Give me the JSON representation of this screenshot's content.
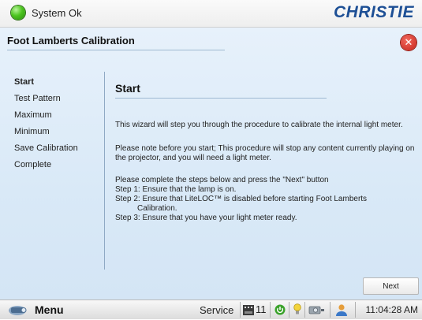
{
  "status": {
    "text": "System Ok",
    "color": "#4cc41f"
  },
  "brand": {
    "logo_text": "CHRISTIE"
  },
  "window": {
    "title": "Foot Lamberts Calibration",
    "close_icon": "close-icon"
  },
  "steps": [
    {
      "label": "Start",
      "active": true
    },
    {
      "label": "Test Pattern",
      "active": false
    },
    {
      "label": "Maximum",
      "active": false
    },
    {
      "label": "Minimum",
      "active": false
    },
    {
      "label": "Save Calibration",
      "active": false
    },
    {
      "label": "Complete",
      "active": false
    }
  ],
  "content": {
    "title": "Start",
    "intro": "This wizard will step you through the procedure to calibrate the internal light meter.",
    "note": "Please note before you start; This procedure will stop any content currently playing on the projector, and you will need a light meter.",
    "instructions": "Please complete the steps below and press the \"Next\" button",
    "step1": "Step 1: Ensure that the lamp is on.",
    "step2a": "Step 2: Ensure that LiteLOC™ is disabled before starting Foot Lamberts",
    "step2b": "Calibration.",
    "step3": "Step 3: Ensure that you have your light meter ready."
  },
  "buttons": {
    "next": "Next"
  },
  "taskbar": {
    "menu_label": "Menu",
    "service_label": "Service",
    "lamp_count": "11",
    "clock": "11:04:28 AM"
  },
  "colors": {
    "panel_bg": "#dbeaf8",
    "logo": "#1d4f95",
    "close": "#c6221a"
  }
}
